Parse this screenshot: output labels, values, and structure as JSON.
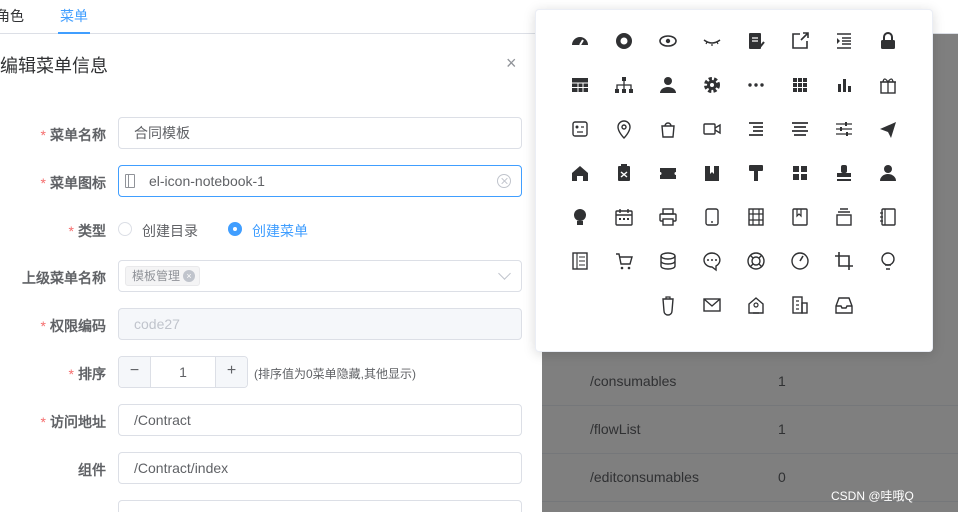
{
  "topnav": {
    "tabs": [
      "角色",
      "菜单"
    ],
    "active_index": 1
  },
  "bg_table": {
    "rows": [
      {
        "path": "/consumables",
        "value": "1"
      },
      {
        "path": "/flowList",
        "value": "1"
      },
      {
        "path": "/editconsumables",
        "value": "0"
      }
    ]
  },
  "dialog": {
    "title": "编辑菜单信息",
    "close_label": "×",
    "fields": {
      "name": {
        "label": "菜单名称",
        "required": "*",
        "value": "合同模板"
      },
      "icon": {
        "label": "菜单图标",
        "required": "*",
        "value": "el-icon-notebook-1"
      },
      "type": {
        "label": "类型",
        "required": "*",
        "options": [
          "创建目录",
          "创建菜单"
        ],
        "selected_index": 1
      },
      "parent": {
        "label": "上级菜单名称",
        "tag": "模板管理",
        "tag_close": "×"
      },
      "perm": {
        "label": "权限编码",
        "required": "*",
        "value": "code27"
      },
      "sort": {
        "label": "排序",
        "required": "*",
        "value": "1",
        "minus": "−",
        "plus": "+",
        "hint": "(排序值为0菜单隐藏,其他显示)"
      },
      "url": {
        "label": "访问地址",
        "required": "*",
        "value": "/Contract"
      },
      "component": {
        "label": "组件",
        "value": "/Contract/index"
      }
    }
  },
  "icon_popover": {
    "rows": [
      [
        "speedometer-icon",
        "life-ring-icon",
        "eye-icon",
        "eye-closed-icon",
        "document-edit-icon",
        "external-link-icon",
        "list-indent-icon",
        "lock-icon"
      ],
      [
        "table-grid-icon",
        "org-chart-icon",
        "user-icon",
        "gear-icon",
        "more-dots-icon",
        "grid-apps-icon",
        "bar-chart-icon",
        "gift-icon"
      ],
      [
        "receipt-icon",
        "location-pin-icon",
        "shopping-bag-icon",
        "video-camera-icon",
        "list-align-icon",
        "align-center-icon",
        "sliders-icon",
        "send-plane-icon"
      ],
      [
        "home-icon",
        "clipboard-icon",
        "ticket-icon",
        "collection-tag-icon",
        "paint-roller-icon",
        "menu-grid-icon",
        "stamp-icon",
        "user-solid-icon"
      ],
      [
        "bulb-solid-icon",
        "calendar-icon",
        "printer-icon",
        "tablet-icon",
        "film-icon",
        "notebook-icon",
        "box-icon",
        "notebook-1-icon"
      ],
      [
        "document-lines-icon",
        "shopping-cart-icon",
        "coin-stack-icon",
        "chat-dots-icon",
        "help-buoy-icon",
        "timer-gauge-icon",
        "crop-icon",
        "bulb-outline-icon"
      ],
      [
        "cup-icon",
        "envelope-icon",
        "house-badge-icon",
        "office-building-icon",
        "inbox-icon"
      ]
    ]
  },
  "watermark": "CSDN @哇哦Q"
}
